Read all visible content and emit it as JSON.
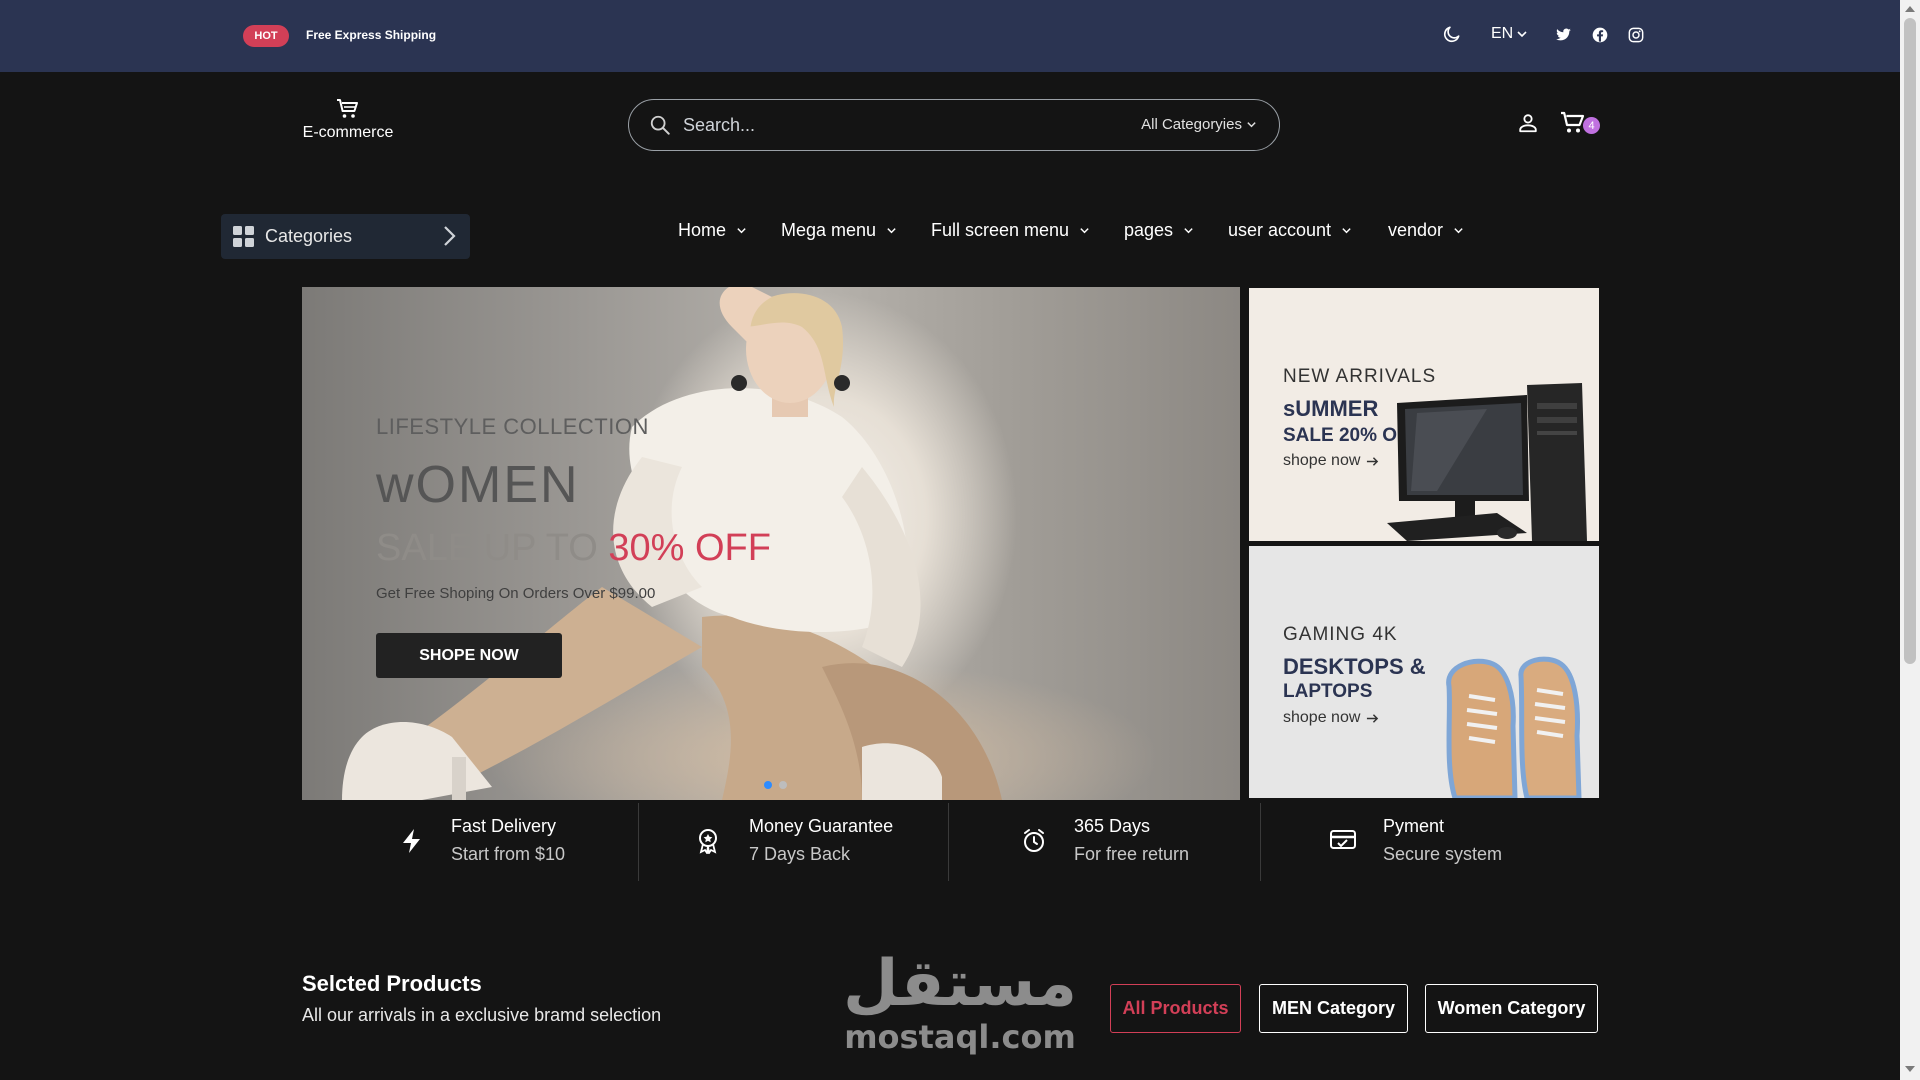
{
  "topbar": {
    "hot_label": "HOT",
    "shipping_text": "Free Express Shipping",
    "language": "EN",
    "icons": [
      "moon-icon",
      "twitter-icon",
      "facebook-icon",
      "instagram-icon"
    ]
  },
  "header": {
    "logo_text": "E-commerce",
    "search_placeholder": "Search...",
    "search_category": "All Categoryies",
    "cart_count": "4"
  },
  "categories_button": {
    "label": "Categories"
  },
  "nav": {
    "items": [
      {
        "label": "Home"
      },
      {
        "label": "Mega menu"
      },
      {
        "label": "Full screen menu"
      },
      {
        "label": "pages"
      },
      {
        "label": "user account"
      },
      {
        "label": "vendor"
      }
    ]
  },
  "hero": {
    "kicker": "LIFESTYLE COLLECTION",
    "title": "wOMEN",
    "sale_prefix": "SALE UP TO ",
    "sale_accent": "30% OFF",
    "subtitle": "Get Free Shoping On Orders Over $99.00",
    "button_label": "SHOPE NOW"
  },
  "promos": [
    {
      "kicker": "NEW ARRIVALS",
      "title": "sUMMER",
      "subtitle": "SALE 20% OFF",
      "link": "shope now"
    },
    {
      "kicker": "GAMING 4K",
      "title": "DESKTOPS &",
      "subtitle": "LAPTOPS",
      "link": "shope now"
    }
  ],
  "features": [
    {
      "title": "Fast Delivery",
      "subtitle": "Start from $10"
    },
    {
      "title": "Money Guarantee",
      "subtitle": "7 Days Back"
    },
    {
      "title": "365 Days",
      "subtitle": "For free return"
    },
    {
      "title": "Pyment",
      "subtitle": "Secure system"
    }
  ],
  "selected": {
    "title": "Selcted Products",
    "subtitle": "All our arrivals in a exclusive bramd selection",
    "filters": [
      {
        "label": "All Products"
      },
      {
        "label": "MEN Category"
      },
      {
        "label": "Women Category"
      }
    ]
  },
  "watermark": {
    "arabic": "مستقل",
    "latin": "mostaql.com"
  },
  "colors": {
    "topbar_bg": "#2b3452",
    "page_bg": "#141414",
    "accent_red": "#d23f57",
    "cart_badge": "#c071e0",
    "slider_active": "#2d8cff"
  }
}
